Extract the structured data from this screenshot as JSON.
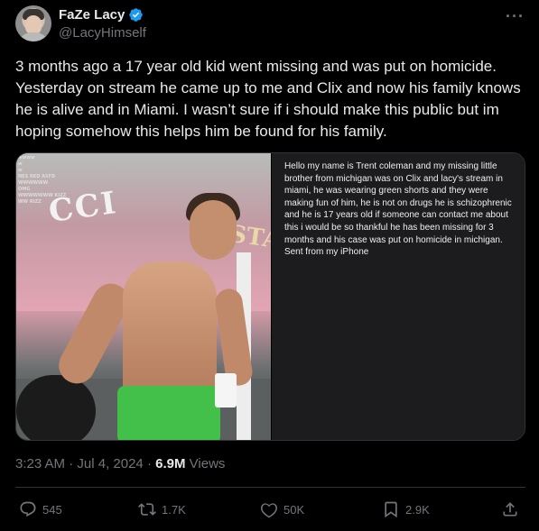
{
  "author": {
    "display_name": "FaZe Lacy",
    "handle": "@LacyHimself",
    "verified_icon": "verified-badge-icon",
    "verified_color": "#1d9bf0"
  },
  "more_label": "···",
  "tweet": {
    "text": "3 months ago a 17 year old kid went missing and was put on homicide. Yesterday on stream he came up to me and Clix and now his family knows he is alive and in Miami. I wasn’t sure if i should make this public but im hoping somehow this helps him be found for his family."
  },
  "media": {
    "photo_overlay_lines": [
      "wwww",
      "w",
      "w",
      "NES RED ASFD",
      "",
      "WWWWWW",
      "OMG",
      "WWWWWWW KIZZ",
      "WW RIZZ"
    ],
    "photo_sign": "CCI",
    "photo_sign2": "STAR",
    "note_text": "Hello my name is Trent coleman and my missing little brother from michigan was on Clix and lacy's stream in miami, he was wearing green shorts and they were making fun of him, he is not on drugs he is schizophrenic and he is 17 years old if someone can contact me about this i would be so thankful he has been missing for 3 months and his case was put on homicide in michigan.\nSent from my iPhone"
  },
  "meta": {
    "time": "3:23 AM",
    "date": "Jul 4, 2024",
    "separator": "·",
    "views_count": "6.9M",
    "views_label": "Views"
  },
  "actions": {
    "replies": "545",
    "reposts": "1.7K",
    "likes": "50K",
    "bookmarks": "2.9K"
  },
  "colors": {
    "background": "#000000",
    "text": "#e7e9ea",
    "secondary": "#71767b",
    "border": "#2f3336"
  }
}
